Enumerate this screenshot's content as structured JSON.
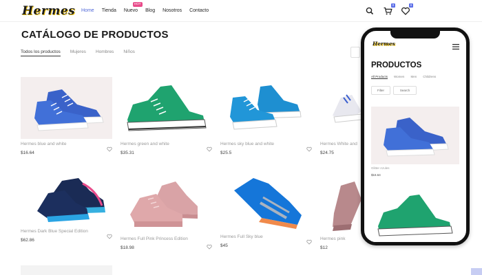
{
  "brand": {
    "logo_text": "Hermes"
  },
  "nav": {
    "items": [
      {
        "label": "Home",
        "active": true
      },
      {
        "label": "Tienda"
      },
      {
        "label": "Nuevo",
        "badge": "HOT"
      },
      {
        "label": "Blog"
      },
      {
        "label": "Nosotros"
      },
      {
        "label": "Contacto"
      }
    ]
  },
  "header_icons": {
    "cart_count": "0",
    "wishlist_count": "0"
  },
  "catalog": {
    "title": "CATÁLOGO DE PRODUCTOS",
    "filters": [
      "Todos los productos",
      "Mujeres",
      "Hombres",
      "Niños"
    ],
    "products": [
      {
        "name": "Hermes blue and white",
        "price": "$16.64"
      },
      {
        "name": "Hermes green and white",
        "price": "$35.31"
      },
      {
        "name": "Hermes sky blue and white",
        "price": "$25.5"
      },
      {
        "name": "Hermes White and",
        "price": "$24.75"
      },
      {
        "name": "Hermes Dark Blue Special Edition",
        "price": "$62.86"
      },
      {
        "name": "Hermes Full Pink Princess Edition",
        "price": "$18.98"
      },
      {
        "name": "Hermes Full Sky blue",
        "price": "$45"
      },
      {
        "name": "Hermes pink",
        "price": "$12"
      }
    ]
  },
  "phone": {
    "logo_text": "Hermes",
    "title": "PRODUCTOS",
    "tabs": [
      "All Products",
      "Women",
      "Men",
      "Childrens"
    ],
    "filter_label": "Filter",
    "search_label": "Search",
    "products": [
      {
        "name": "Glitter Azules",
        "price": "$16.64"
      }
    ]
  },
  "colors": {
    "accent": "#4f67d8",
    "badge": "#5b6ee8",
    "hot": "#e84b8a"
  }
}
